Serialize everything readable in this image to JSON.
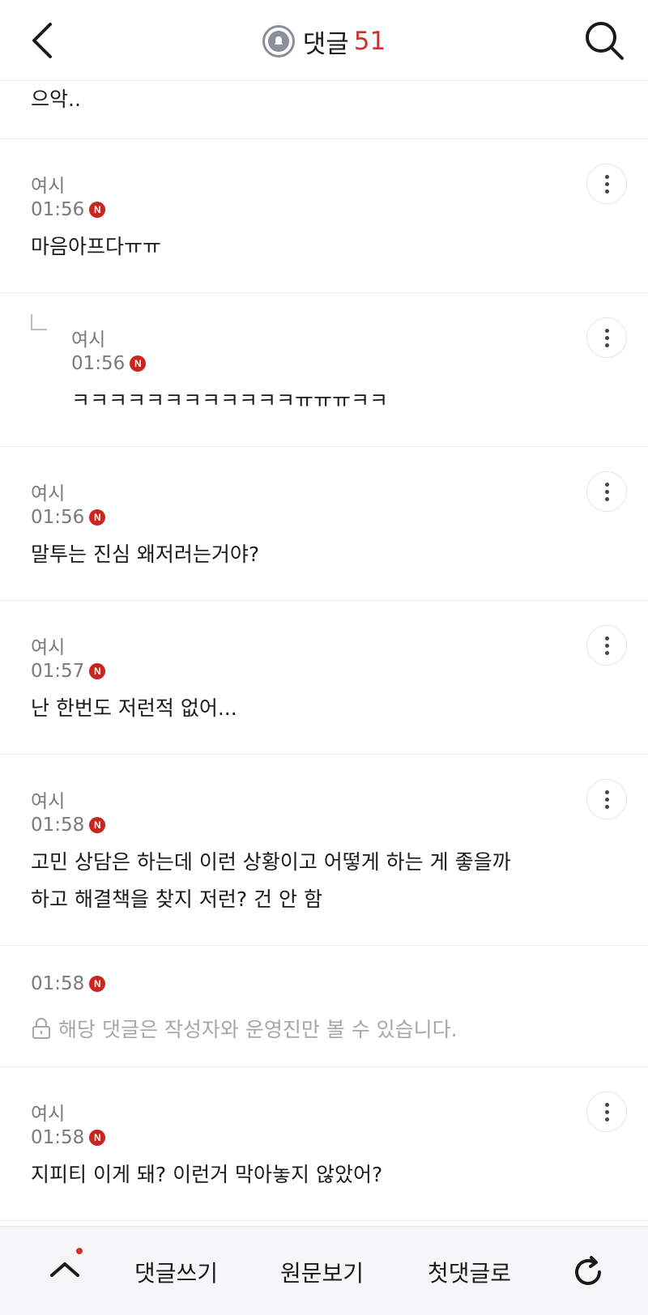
{
  "header": {
    "back_icon": "chevron-left-icon",
    "bell_icon": "bell-icon",
    "title": "댓글",
    "count": "51",
    "search_icon": "search-icon"
  },
  "partial_comment": {
    "text": "으악.."
  },
  "comments": [
    {
      "author": "여시",
      "time": "01:56",
      "badge": "N",
      "text": "마음아프다ㅠㅠ"
    },
    {
      "author": "여시",
      "time": "01:56",
      "badge": "N",
      "text": "ㅋㅋㅋㅋㅋㅋㅋㅋㅋㅋㅋㅋㅠㅠㅠㅋㅋ",
      "reply": true
    },
    {
      "author": "여시",
      "time": "01:56",
      "badge": "N",
      "text": "말투는 진심 왜저러는거야?"
    },
    {
      "author": "여시",
      "time": "01:57",
      "badge": "N",
      "text": "난 한번도 저런적 없어..."
    },
    {
      "author": "여시",
      "time": "01:58",
      "badge": "N",
      "text_line1": "고민 상담은 하는데 이런 상황이고 어떻게 하는 게 좋을까",
      "text_line2": "하고 해결책을 찾지 저런? 건 안 함"
    },
    {
      "time": "01:58",
      "badge": "N",
      "private_text": "해당 댓글은 작성자와 운영진만 볼 수 있습니다."
    },
    {
      "author": "여시",
      "time": "01:58",
      "badge": "N",
      "text": "지피티 이게 돼? 이런거 막아놓지 않았어?"
    }
  ],
  "bottom_bar": {
    "up_icon": "chevron-up-icon",
    "write": "댓글쓰기",
    "original": "원문보기",
    "first": "첫댓글로",
    "refresh_icon": "refresh-icon"
  }
}
